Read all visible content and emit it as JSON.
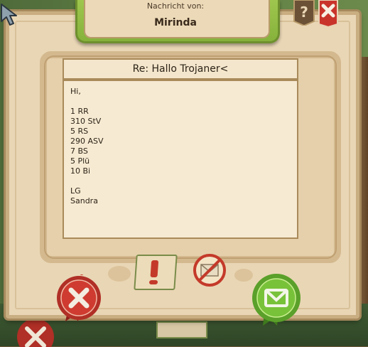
{
  "header": {
    "label": "Nachricht von:",
    "sender": "Mirinda"
  },
  "message": {
    "subject": "Re: Hallo Trojaner<",
    "body_lines": [
      "Hi,",
      "",
      "1 RR",
      "310 StV",
      "5 RS",
      "290 ASV",
      "7 BS",
      "5 Plü",
      "10 Bi",
      "",
      "LG",
      "Sandra"
    ]
  },
  "actions": {
    "report": "exclamation-report-icon",
    "block": "no-mail-block-icon",
    "delete": "delete-x-icon",
    "reply": "reply-envelope-icon",
    "close": "close-x-icon",
    "help": "question-help-icon"
  },
  "colors": {
    "banner_green": "#8fbc45",
    "parchment": "#e9d6b5",
    "delete_red": "#c8372d",
    "reply_green": "#6cb232"
  }
}
